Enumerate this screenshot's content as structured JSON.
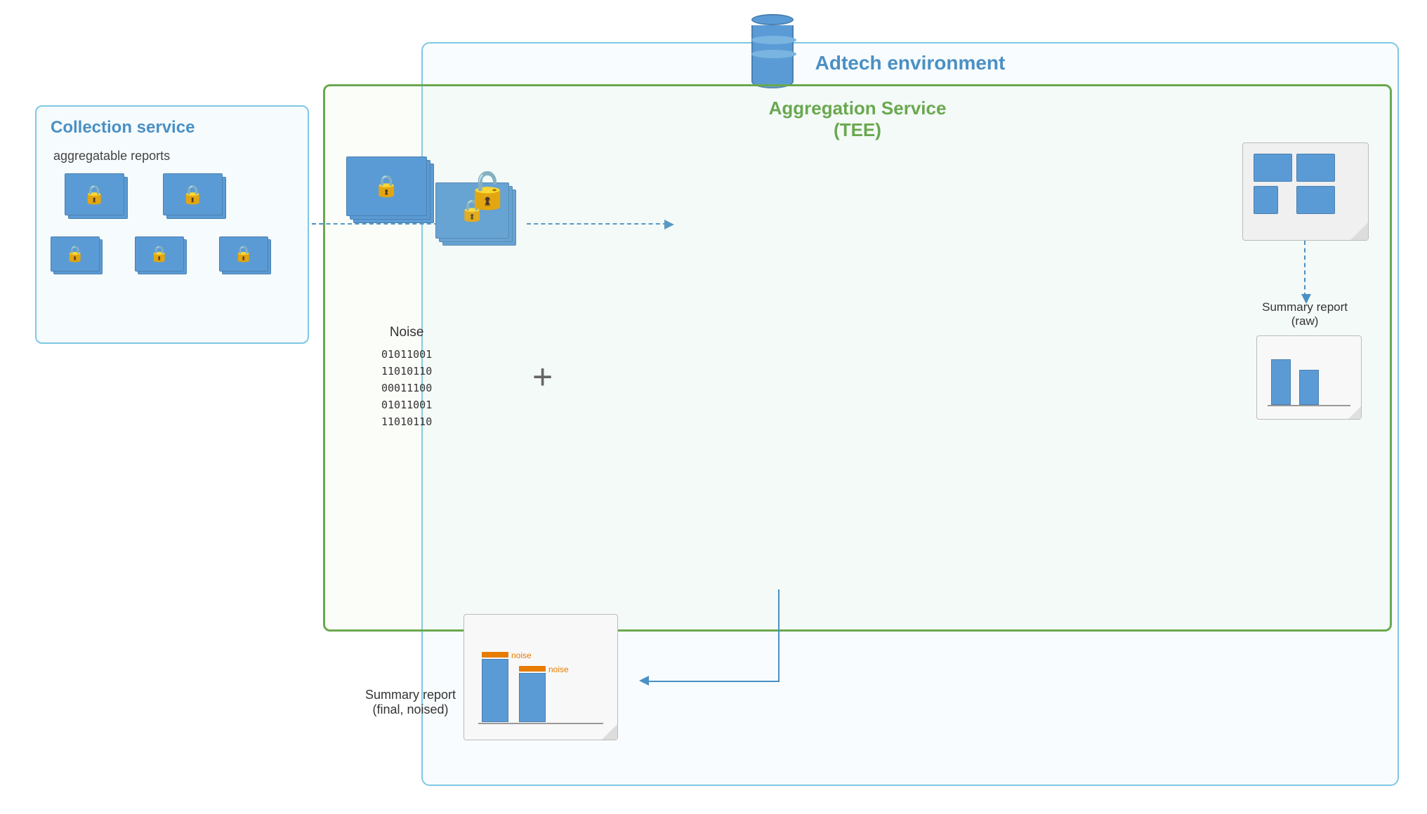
{
  "adtech": {
    "title": "Adtech environment"
  },
  "collection_service": {
    "title": "Collection service",
    "subtitle": "aggregatable reports"
  },
  "aggregation_service": {
    "title": "Aggregation Service",
    "subtitle": "(TEE)"
  },
  "noise": {
    "label": "Noise",
    "binary": [
      "01011001",
      "11010110",
      "00011100",
      "01011001",
      "11010110"
    ]
  },
  "summary_raw": {
    "label": "Summary report",
    "sublabel": "(raw)"
  },
  "summary_final": {
    "label": "Summary report",
    "sublabel": "(final, noised)"
  },
  "noise_labels": {
    "n1": "noise",
    "n2": "noise"
  }
}
